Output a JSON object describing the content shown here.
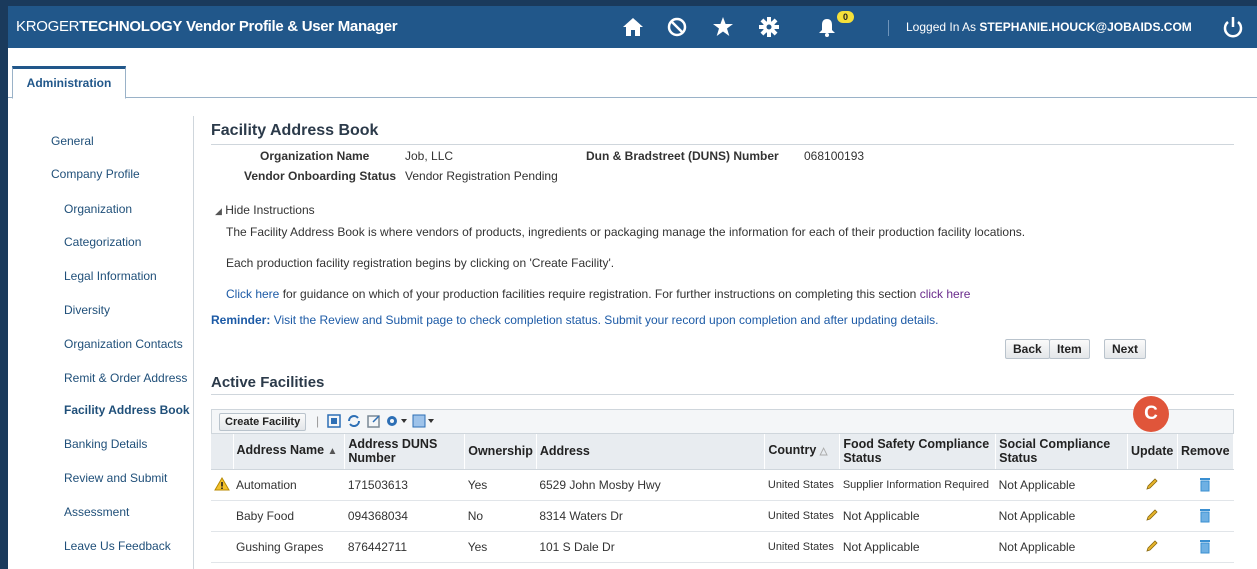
{
  "header": {
    "brand_kroger": "KROGER",
    "brand_technology": "TECHNOLOGY",
    "brand_product": "Vendor Profile & User Manager",
    "notification_count": "0",
    "logged_in_prefix": "Logged In As",
    "logged_in_user": "STEPHANIE.HOUCK@JOBAIDS.COM"
  },
  "tabs": [
    {
      "label": "Administration"
    }
  ],
  "sidebar": {
    "items": [
      {
        "label": "General"
      },
      {
        "label": "Company Profile"
      },
      {
        "label": "Organization"
      },
      {
        "label": "Categorization"
      },
      {
        "label": "Legal Information"
      },
      {
        "label": "Diversity"
      },
      {
        "label": "Organization Contacts"
      },
      {
        "label": "Remit & Order Address"
      },
      {
        "label": "Facility Address Book"
      },
      {
        "label": "Banking Details"
      },
      {
        "label": "Review and Submit"
      },
      {
        "label": "Assessment"
      },
      {
        "label": "Leave Us Feedback"
      }
    ]
  },
  "page": {
    "title": "Facility Address Book",
    "org_name_label": "Organization Name",
    "org_name_value": "Job, LLC",
    "duns_label": "Dun & Bradstreet (DUNS) Number",
    "duns_value": "068100193",
    "onboarding_label": "Vendor Onboarding Status",
    "onboarding_value": "Vendor Registration Pending",
    "hide_instructions": "Hide Instructions",
    "instruction_1": "The Facility Address Book is where vendors of products, ingredients or packaging manage the information for each of their production facility locations.",
    "instruction_2": "Each production facility registration begins by clicking on 'Create Facility'.",
    "instruction_3_link": "Click here",
    "instruction_3_text": "for guidance on which of your production facilities require registration. For further instructions on completing this section",
    "instruction_3_link2": "click here",
    "reminder_label": "Reminder:",
    "reminder_text": "Visit the Review and Submit page to check completion status. Submit your record upon completion and after updating details.",
    "btn_back": "Back",
    "btn_item": "Item",
    "btn_next": "Next",
    "section_title": "Active Facilities",
    "create_facility": "Create Facility",
    "callout_letter": "C"
  },
  "table": {
    "columns": [
      "Address Name",
      "Address DUNS Number",
      "Ownership",
      "Address",
      "Country",
      "Food Safety Compliance Status",
      "Social Compliance Status",
      "Update",
      "Remove"
    ],
    "rows": [
      {
        "warning": true,
        "name": "Automation",
        "duns": "171503613",
        "ownership": "Yes",
        "address": "6529 John Mosby Hwy",
        "country": "United States",
        "food": "Supplier Information Required",
        "social": "Not Applicable"
      },
      {
        "warning": false,
        "name": "Baby Food",
        "duns": "094368034",
        "ownership": "No",
        "address": "8314 Waters Dr",
        "country": "United States",
        "food": "Not Applicable",
        "social": "Not Applicable"
      },
      {
        "warning": false,
        "name": "Gushing Grapes",
        "duns": "876442711",
        "ownership": "Yes",
        "address": "101 S Dale Dr",
        "country": "United States",
        "food": "Not Applicable",
        "social": "Not Applicable"
      }
    ]
  },
  "colors": {
    "header_bg": "#21578a",
    "link": "#1c5aa6",
    "callout": "#e0553a",
    "badge": "#f5e03a"
  }
}
